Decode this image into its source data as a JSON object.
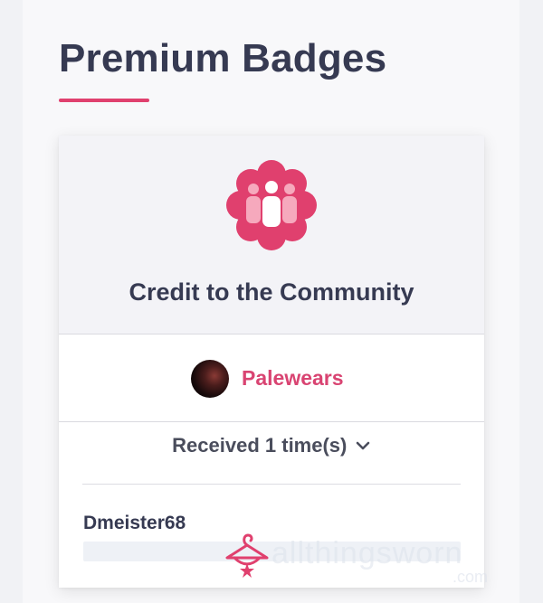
{
  "page": {
    "title": "Premium Badges"
  },
  "badge": {
    "name": "Credit to the Community",
    "icon": "community-group-icon",
    "accent_color": "#e0406e"
  },
  "owner": {
    "name": "Palewears",
    "avatar_icon": "avatar-image"
  },
  "received": {
    "label": "Received 1 time(s)",
    "chevron_icon": "chevron-down-icon"
  },
  "recipients": [
    {
      "name": "Dmeister68"
    }
  ],
  "watermark": {
    "text": "allthingsworn",
    "suffix": ".com",
    "icon": "hanger-logo-icon"
  }
}
